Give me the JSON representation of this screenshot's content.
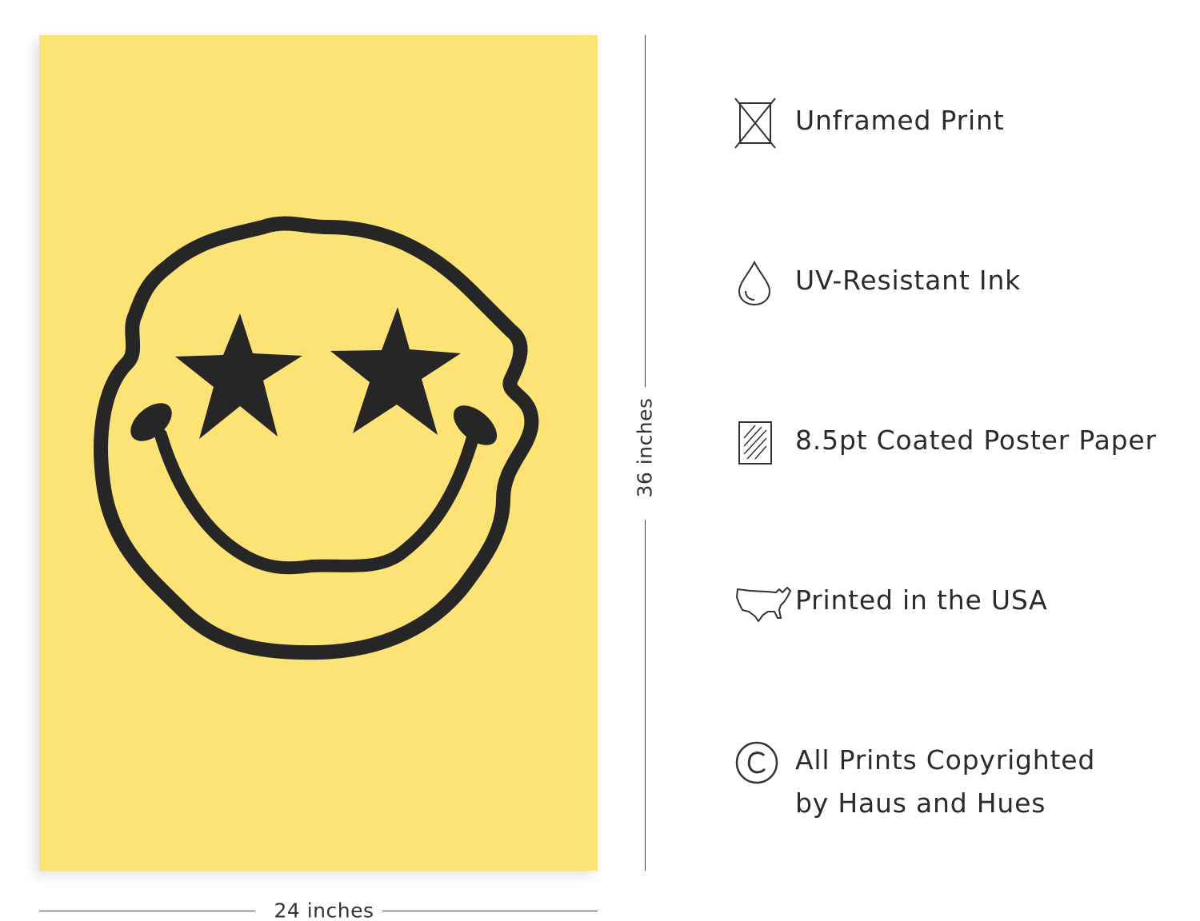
{
  "poster": {
    "background_color": "#fde276",
    "line_color": "#262626",
    "artwork": "smiley-face-star-eyes"
  },
  "dimensions": {
    "height_label": "36 inches",
    "width_label": "24 inches"
  },
  "features": [
    {
      "icon": "unframed-print-icon",
      "label": "Unframed Print"
    },
    {
      "icon": "ink-drop-icon",
      "label": "UV-Resistant Ink"
    },
    {
      "icon": "coated-paper-icon",
      "label": "8.5pt Coated Poster Paper"
    },
    {
      "icon": "usa-map-icon",
      "label": "Printed in the USA"
    },
    {
      "icon": "copyright-icon",
      "label_line1": "All Prints Copyrighted",
      "label_line2": "by Haus and Hues"
    }
  ]
}
